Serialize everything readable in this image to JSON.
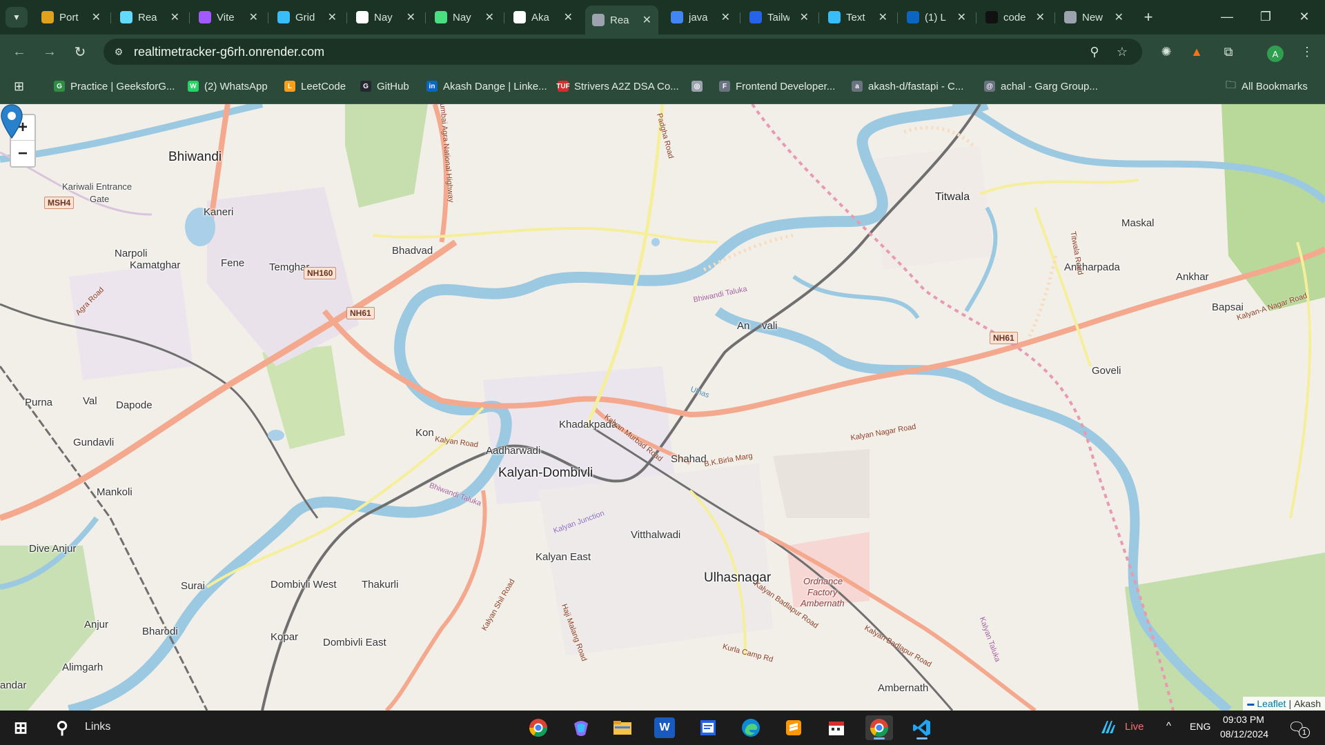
{
  "browser": {
    "tabs": [
      {
        "label": "Port",
        "icon": "portfolio-icon",
        "color": "#e0a21c"
      },
      {
        "label": "Rea",
        "icon": "react-icon",
        "color": "#61dafb"
      },
      {
        "label": "Vite",
        "icon": "vite-icon",
        "color": "#a259ff"
      },
      {
        "label": "Grid",
        "icon": "tailwind-icon",
        "color": "#38bdf8"
      },
      {
        "label": "Nay",
        "icon": "github-icon",
        "color": "#ffffff"
      },
      {
        "label": "Nay",
        "icon": "code-icon",
        "color": "#4ade80"
      },
      {
        "label": "Aka",
        "icon": "github-icon",
        "color": "#ffffff"
      },
      {
        "label": "Rea",
        "icon": "globe-icon",
        "color": "#9ca3af",
        "active": true
      },
      {
        "label": "java",
        "icon": "google-icon",
        "color": "#4285f4"
      },
      {
        "label": "Tailw",
        "icon": "edge-icon",
        "color": "#2563eb"
      },
      {
        "label": "Text",
        "icon": "tailwind-icon",
        "color": "#38bdf8"
      },
      {
        "label": "(1) L",
        "icon": "linkedin-icon",
        "color": "#0a66c2"
      },
      {
        "label": "code",
        "icon": "triangle-icon",
        "color": "#111111"
      },
      {
        "label": "New",
        "icon": "chrome-icon",
        "color": "#9ca3af"
      }
    ],
    "url": "realtimetracker-g6rh.onrender.com",
    "profile_initial": "A",
    "bookmarks": [
      {
        "label": "Practice | GeeksforG...",
        "color": "#2f8d46",
        "glyph": "G"
      },
      {
        "label": "(2) WhatsApp",
        "color": "#25d366",
        "glyph": "W"
      },
      {
        "label": "LeetCode",
        "color": "#f89f1b",
        "glyph": "L"
      },
      {
        "label": "GitHub",
        "color": "#24292f",
        "glyph": "G"
      },
      {
        "label": "Akash Dange | Linke...",
        "color": "#0a66c2",
        "glyph": "in"
      },
      {
        "label": "Strivers A2Z DSA Co...",
        "color": "#d32f2f",
        "glyph": "TUF"
      },
      {
        "label": "",
        "color": "#9ca3af",
        "glyph": "◎"
      },
      {
        "label": "Frontend Developer...",
        "color": "#6b7280",
        "glyph": "F"
      },
      {
        "label": "akash-d/fastapi - C...",
        "color": "#6b7280",
        "glyph": "a"
      },
      {
        "label": "achal - Garg Group...",
        "color": "#6b7280",
        "glyph": "@"
      }
    ],
    "all_bookmarks": "All Bookmarks"
  },
  "map": {
    "zoom_in": "+",
    "zoom_out": "−",
    "attribution_flag": "▬",
    "attribution_leaflet": "Leaflet",
    "attribution_sep": "|",
    "attribution_owner": "Akash",
    "marker_place": "Ambivli",
    "places": {
      "bhiwandi": "Bhiwandi",
      "kariwali": "Kariwali Entrance",
      "gate": "Gate",
      "kaneri": "Kaneri",
      "narpoli": "Narpoli",
      "fene": "Fene",
      "kamatghar": "Kamatghar",
      "temghar": "Temghar",
      "bhadvad": "Bhadvad",
      "titwala": "Titwala",
      "maskal": "Maskal",
      "ankharpada": "Ankharpada",
      "ankhar": "Ankhar",
      "bapsai": "Bapsai",
      "goveli": "Goveli",
      "ambivli_left": "An",
      "ambivli_right": "vali",
      "purna": "Purna",
      "val": "Val",
      "dapode": "Dapode",
      "gundavli": "Gundavli",
      "kon": "Kon",
      "aadharwadi": "Aadharwadi",
      "khadakpada": "Khadakpada",
      "shahad": "Shahad",
      "kalyan_dombivli": "Kalyan-Dombivli",
      "mankoli": "Mankoli",
      "dive_anjur": "Dive Anjur",
      "vitthalwadi": "Vitthalwadi",
      "kalyan_east": "Kalyan East",
      "ulhasnagar": "Ulhasnagar",
      "ordnance1": "Ordnance",
      "ordnance2": "Factory",
      "ordnance3": "Ambernath",
      "surai": "Surai",
      "dombivli_west": "Dombivli West",
      "thakurli": "Thakurli",
      "anjur": "Anjur",
      "bharodi": "Bharodi",
      "kopar": "Kopar",
      "dombivli_east": "Dombivli East",
      "alimgarh": "Alimgarh",
      "andar": "andar",
      "ambernath": "Ambernath"
    },
    "road_labels": {
      "agra_road": "Agra Road",
      "mumbai_agra": "Mumbai Agra National Highway",
      "padgha": "Padgha Road",
      "bhiwandi_taluka": "Bhiwandi Taluka",
      "ulhas": "Ulhas",
      "kalyan_road": "Kalyan Road",
      "murbad_road": "Kalyan Murbad Road",
      "bk_birla": "B.K.Birla Marg",
      "kalyan_nagar": "Kalyan Nagar Road",
      "kalyan_anagar": "Kalyan-A Nagar Road",
      "titwala_road": "Titwala Road",
      "badlapur": "Kalyan Badlapur Road",
      "kurla_camp": "Kurla Camp Rd",
      "kalyan_taluka": "Kalyan Taluka",
      "kalyan_junction": "Kalyan Junction",
      "shil_road": "Kalyan Shil Road",
      "haji_malang": "Haji Malang Road"
    },
    "shields": [
      "MSH4",
      "NH160",
      "NH61",
      "NH61"
    ]
  },
  "taskbar": {
    "search_label": "Links",
    "apps": [
      "chrome-icon",
      "copilot-icon",
      "file-explorer-icon",
      "word-icon",
      "notepad-icon",
      "edge-icon",
      "sublime-icon",
      "calendar-icon",
      "chrome-active-icon",
      "vscode-icon"
    ],
    "weather_label": "Live",
    "lang": "ENG",
    "time": "09:03 PM",
    "date": "08/12/2024",
    "notif_count": "1"
  }
}
